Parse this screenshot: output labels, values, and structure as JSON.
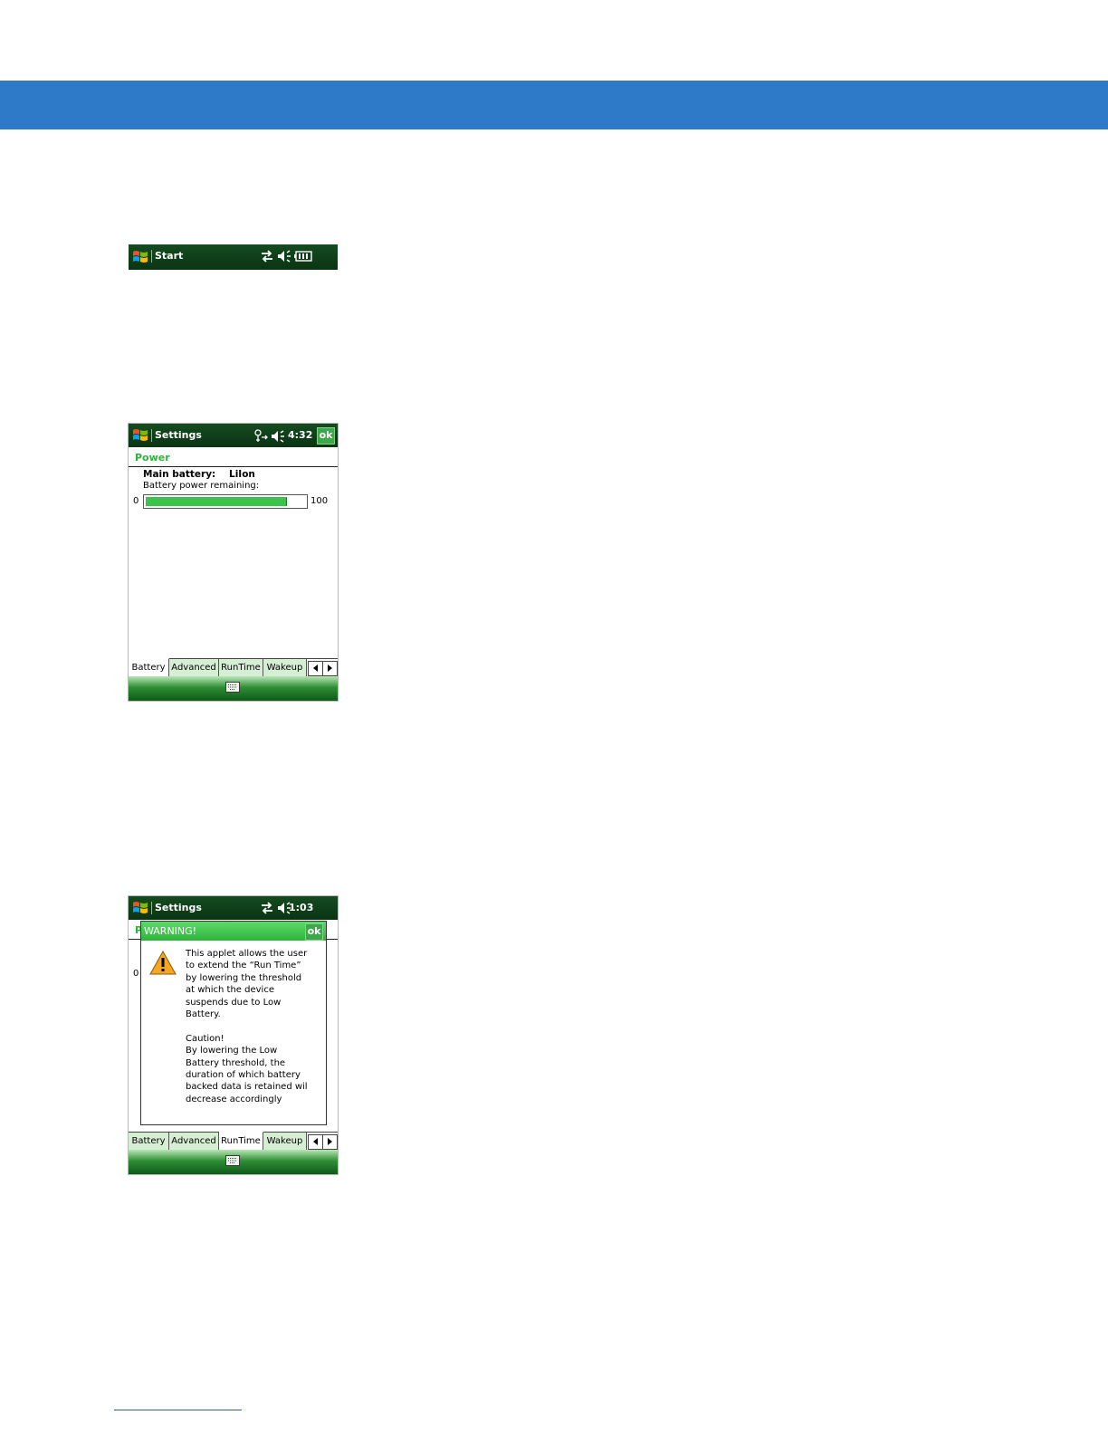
{
  "colors": {
    "header_band": "#2e79c8",
    "device_titlebar": "#0b3b16",
    "accent_green": "#2fb43b",
    "progress_fill": "#3bc34a"
  },
  "screen_start": {
    "title": "Start",
    "icons": [
      "windows-flag-icon",
      "connectivity-icon",
      "speaker-icon",
      "battery-icon"
    ]
  },
  "screen_power": {
    "title": "Settings",
    "time": "4:32",
    "ok_label": "ok",
    "subtitle": "Power",
    "main_battery_label": "Main battery:",
    "main_battery_value": "LiIon",
    "remaining_label": "Battery power remaining:",
    "scale_min": "0",
    "scale_max": "100",
    "battery_percent": 88,
    "tabs": [
      {
        "label": "Battery",
        "active": true
      },
      {
        "label": "Advanced",
        "active": false
      },
      {
        "label": "RunTime",
        "active": false
      },
      {
        "label": "Wakeup",
        "active": false
      }
    ]
  },
  "screen_warning": {
    "title": "Settings",
    "time": "1:03",
    "behind_subtitle_fragment": "P",
    "behind_scale_fragment": "0",
    "dialog_title": "WARNING!",
    "ok_label": "ok",
    "message": "This applet allows the user\nto extend the “Run Time”\nby lowering the threshold\nat which the device\nsuspends due to Low\nBattery.\n\nCaution!\nBy lowering the Low\nBattery threshold, the\nduration of which battery\nbacked data is retained wil\ndecrease accordingly",
    "tabs": [
      {
        "label": "Battery",
        "active": false
      },
      {
        "label": "Advanced",
        "active": false
      },
      {
        "label": "RunTime",
        "active": true
      },
      {
        "label": "Wakeup",
        "active": false
      }
    ]
  }
}
